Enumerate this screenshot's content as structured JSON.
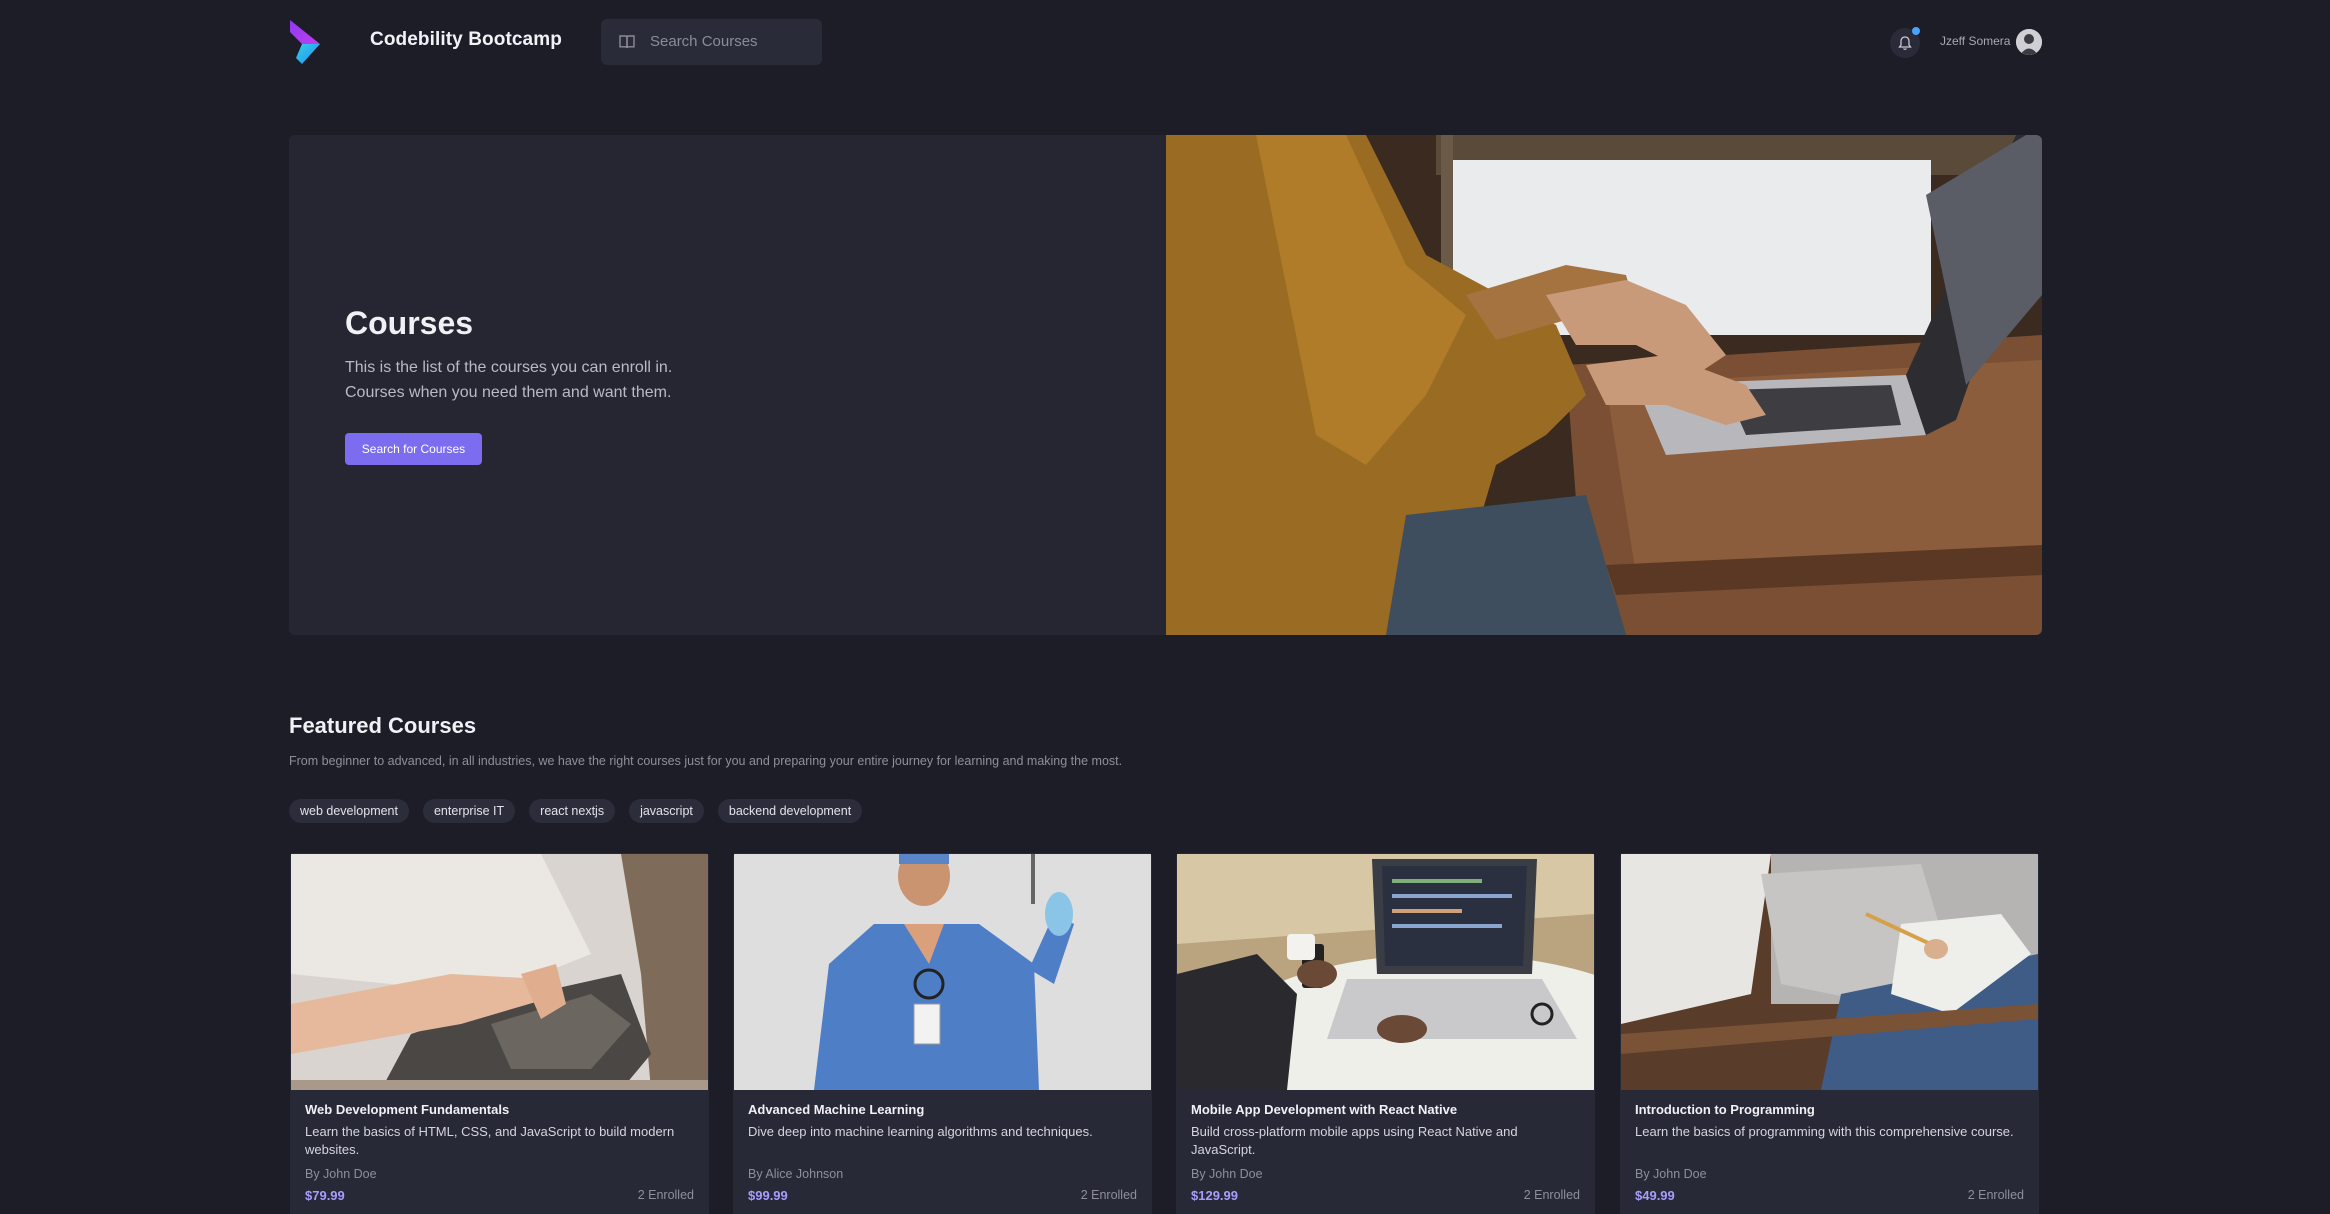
{
  "header": {
    "brand": "Codebility Bootcamp",
    "search_placeholder": "Search Courses",
    "username": "Jzeff Somera"
  },
  "hero": {
    "title": "Courses",
    "line1": "This is the list of the courses you can enroll in.",
    "line2": "Courses when you need them and want them.",
    "button": "Search for Courses"
  },
  "featured": {
    "title": "Featured Courses",
    "subtitle": "From beginner to advanced, in all industries, we have the right courses just for you and preparing your entire journey for learning and making the most.",
    "tags": [
      "web development",
      "enterprise IT",
      "react nextjs",
      "javascript",
      "backend development"
    ]
  },
  "courses": [
    {
      "title": "Web Development Fundamentals",
      "description": "Learn the basics of HTML, CSS, and JavaScript to build modern websites.",
      "author": "By John Doe",
      "price": "$79.99",
      "enrolled": "2 Enrolled"
    },
    {
      "title": "Advanced Machine Learning",
      "description": "Dive deep into machine learning algorithms and techniques.",
      "author": "By Alice Johnson",
      "price": "$99.99",
      "enrolled": "2 Enrolled"
    },
    {
      "title": "Mobile App Development with React Native",
      "description": "Build cross-platform mobile apps using React Native and JavaScript.",
      "author": "By John Doe",
      "price": "$129.99",
      "enrolled": "2 Enrolled"
    },
    {
      "title": "Introduction to Programming",
      "description": "Learn the basics of programming with this comprehensive course.",
      "author": "By John Doe",
      "price": "$49.99",
      "enrolled": "2 Enrolled"
    }
  ],
  "colors": {
    "background": "#1d1d28",
    "panel": "#262633",
    "accent": "#7b6cf0",
    "price": "#a79dff",
    "notification_dot": "#4aa3ff"
  },
  "icons": [
    "logo-icon",
    "book-icon",
    "bell-icon",
    "avatar"
  ]
}
